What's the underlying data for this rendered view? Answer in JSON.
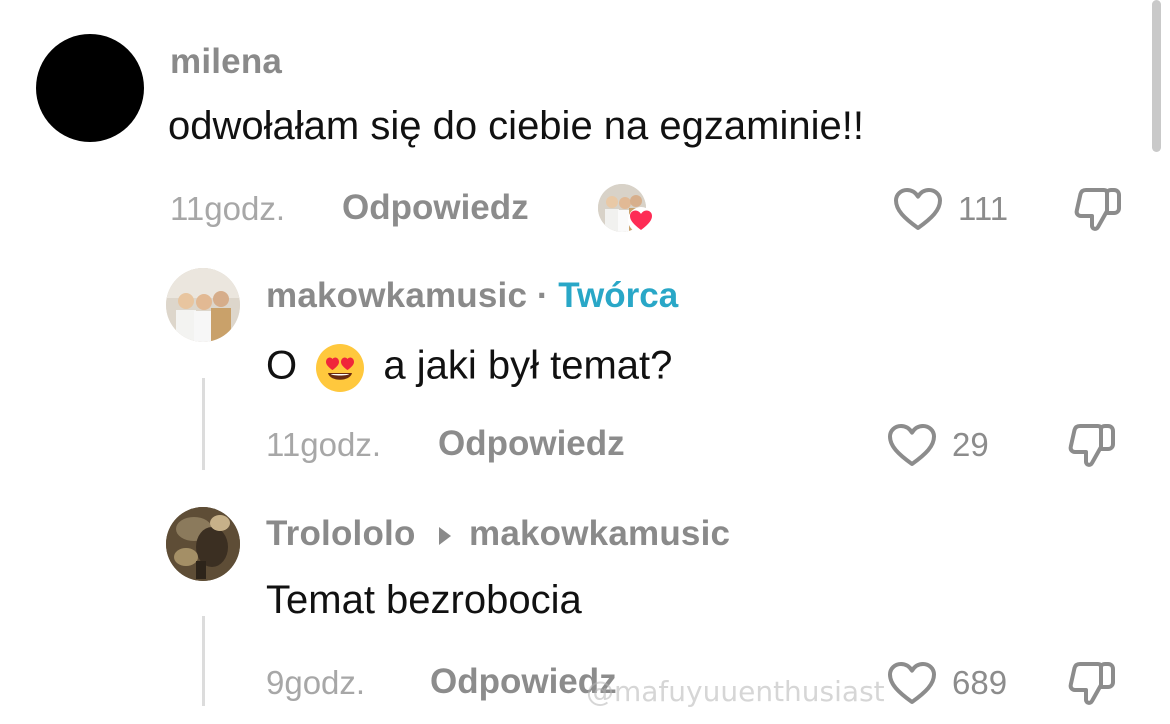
{
  "comments": [
    {
      "username": "milena",
      "text": "odwołałam się do ciebie na egzaminie!!",
      "time": "11godz.",
      "reply_label": "Odpowiedz",
      "likes": "111"
    },
    {
      "username": "makowkamusic",
      "separator": "·",
      "badge": "Twórca",
      "text_prefix": "O",
      "emoji": "😍",
      "text_suffix": "a jaki był temat?",
      "time": "11godz.",
      "reply_label": "Odpowiedz",
      "likes": "29"
    },
    {
      "username": "Trolololo",
      "reply_to": "makowkamusic",
      "text": "Temat bezrobocia",
      "time": "9godz.",
      "reply_label": "Odpowiedz",
      "likes": "689"
    }
  ],
  "icons": {
    "like": "heart-outline-icon",
    "dislike": "thumbs-down-icon",
    "creator_liked": "heart-badge-icon",
    "reply_arrow": "caret-right-icon"
  },
  "colors": {
    "badge": "#29a7c7",
    "creator_heart": "#fe2c55"
  },
  "watermark": "@mafuyuuenthusiast"
}
